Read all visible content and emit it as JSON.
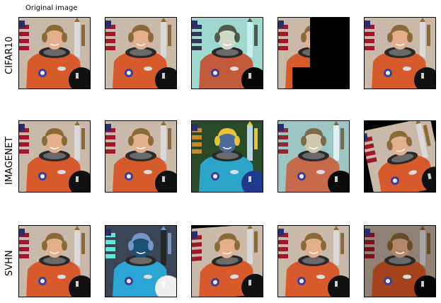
{
  "caption": "Original image",
  "rows": [
    {
      "label": "CIFAR10",
      "panels": [
        {
          "variant": "original"
        },
        {
          "variant": "original"
        },
        {
          "variant": "cyan-invert"
        },
        {
          "variant": "zoom-black"
        },
        {
          "variant": "original"
        }
      ]
    },
    {
      "label": "IMAGENET",
      "panels": [
        {
          "variant": "original"
        },
        {
          "variant": "original"
        },
        {
          "variant": "posterize"
        },
        {
          "variant": "teal"
        },
        {
          "variant": "rotated"
        }
      ]
    },
    {
      "label": "SVHN",
      "panels": [
        {
          "variant": "original"
        },
        {
          "variant": "inverted"
        },
        {
          "variant": "skew"
        },
        {
          "variant": "original"
        },
        {
          "variant": "dark"
        }
      ]
    }
  ]
}
